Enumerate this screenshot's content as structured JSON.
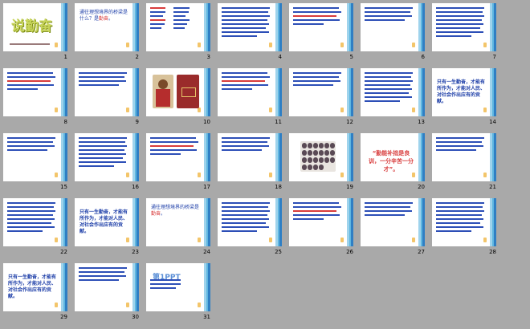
{
  "slides": [
    {
      "n": "1",
      "kind": "title",
      "title": "说勤奋",
      "highlight": false
    },
    {
      "n": "2",
      "kind": "q",
      "text": "通往理想境界的桥梁是什么？是",
      "red": "勤奋",
      "tail": "。"
    },
    {
      "n": "3",
      "kind": "cols"
    },
    {
      "n": "4",
      "kind": "text"
    },
    {
      "n": "5",
      "kind": "text"
    },
    {
      "n": "6",
      "kind": "text"
    },
    {
      "n": "7",
      "kind": "text"
    },
    {
      "n": "8",
      "kind": "text"
    },
    {
      "n": "9",
      "kind": "text"
    },
    {
      "n": "10",
      "kind": "portrait"
    },
    {
      "n": "11",
      "kind": "text"
    },
    {
      "n": "12",
      "kind": "text"
    },
    {
      "n": "13",
      "kind": "text"
    },
    {
      "n": "14",
      "kind": "quote",
      "text": "只有一生勤奋，才能有所作为，才能对人民、对社会作出应有的贡献。"
    },
    {
      "n": "15",
      "kind": "text"
    },
    {
      "n": "16",
      "kind": "text"
    },
    {
      "n": "17",
      "kind": "text"
    },
    {
      "n": "18",
      "kind": "text"
    },
    {
      "n": "19",
      "kind": "beans"
    },
    {
      "n": "20",
      "kind": "bigred",
      "text": "“勤能补拙是良训，一分辛苦一分才”。"
    },
    {
      "n": "21",
      "kind": "text"
    },
    {
      "n": "22",
      "kind": "text"
    },
    {
      "n": "23",
      "kind": "quote",
      "text": "只有一生勤奋，才能有所作为，才能对人民、对社会作出应有的贡献。"
    },
    {
      "n": "24",
      "kind": "q",
      "text": "通往理想境界的桥梁是",
      "red": "勤奋",
      "tail": "。"
    },
    {
      "n": "25",
      "kind": "text"
    },
    {
      "n": "26",
      "kind": "text"
    },
    {
      "n": "27",
      "kind": "text"
    },
    {
      "n": "28",
      "kind": "text"
    },
    {
      "n": "29",
      "kind": "quote",
      "text": "只有一生勤奋，才能有所作为，才能对人民、对社会作出应有的贡献。"
    },
    {
      "n": "30",
      "kind": "text"
    },
    {
      "n": "31",
      "kind": "logo",
      "text": "第1PPT"
    }
  ]
}
